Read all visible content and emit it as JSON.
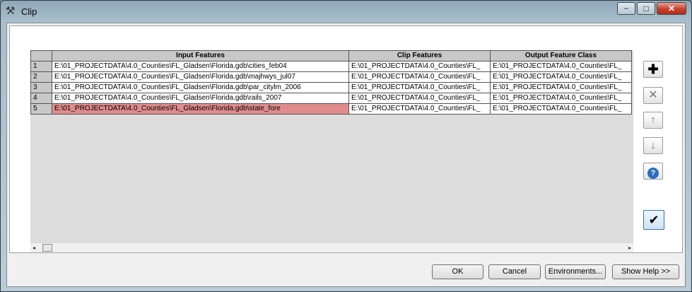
{
  "window": {
    "title": "Clip",
    "minimize_glyph": "−",
    "maximize_glyph": "□",
    "close_glyph": "✕"
  },
  "grid": {
    "columns": [
      "Input Features",
      "Clip Features",
      "Output Feature Class"
    ],
    "rows": [
      {
        "num": "1",
        "input": "E:\\01_PROJECTDATA\\4.0_Counties\\FL_Gladsen\\Florida.gdb\\cities_feb04",
        "clip": "E:\\01_PROJECTDATA\\4.0_Counties\\FL_",
        "output": "E:\\01_PROJECTDATA\\4.0_Counties\\FL_"
      },
      {
        "num": "2",
        "input": "E:\\01_PROJECTDATA\\4.0_Counties\\FL_Gladsen\\Florida.gdb\\majhwys_jul07",
        "clip": "E:\\01_PROJECTDATA\\4.0_Counties\\FL_",
        "output": "E:\\01_PROJECTDATA\\4.0_Counties\\FL_"
      },
      {
        "num": "3",
        "input": "E:\\01_PROJECTDATA\\4.0_Counties\\FL_Gladsen\\Florida.gdb\\par_citylm_2006",
        "clip": "E:\\01_PROJECTDATA\\4.0_Counties\\FL_",
        "output": "E:\\01_PROJECTDATA\\4.0_Counties\\FL_"
      },
      {
        "num": "4",
        "input": "E:\\01_PROJECTDATA\\4.0_Counties\\FL_Gladsen\\Florida.gdb\\rails_2007",
        "clip": "E:\\01_PROJECTDATA\\4.0_Counties\\FL_",
        "output": "E:\\01_PROJECTDATA\\4.0_Counties\\FL_"
      },
      {
        "num": "5",
        "input": "E:\\01_PROJECTDATA\\4.0_Counties\\FL_Gladsen\\Florida.gdb\\state_fore",
        "clip": "E:\\01_PROJECTDATA\\4.0_Counties\\FL_",
        "output": "E:\\01_PROJECTDATA\\4.0_Counties\\FL_"
      }
    ],
    "selected_row": "5",
    "selected_color": "#e08c8c"
  },
  "side_buttons": {
    "add_glyph": "✚",
    "remove_glyph": "✕",
    "up_glyph": "↑",
    "down_glyph": "↓",
    "help_glyph": "?",
    "check_glyph": "✔"
  },
  "buttons": {
    "ok": "OK",
    "cancel": "Cancel",
    "environments": "Environments...",
    "show_help": "Show Help >>"
  },
  "scrollbar": {
    "left_glyph": "◂",
    "right_glyph": "▸"
  }
}
